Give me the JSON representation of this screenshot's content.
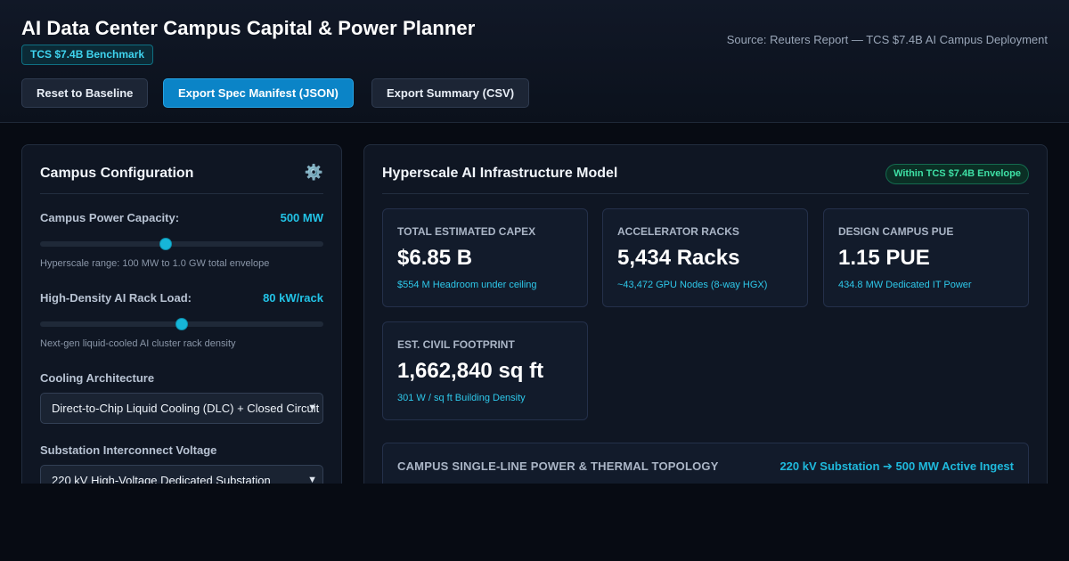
{
  "header": {
    "title": "AI Data Center Campus Capital & Power Planner",
    "badge": "TCS $7.4B Benchmark",
    "source": "Source: Reuters Report — TCS $7.4B AI Campus Deployment",
    "buttons": {
      "reset": "Reset to Baseline",
      "export_json": "Export Spec Manifest (JSON)",
      "export_csv": "Export Summary (CSV)"
    }
  },
  "config": {
    "title": "Campus Configuration",
    "icon": "gear-icon",
    "power": {
      "label": "Campus Power Capacity:",
      "value": "500 MW",
      "slider_fraction": 0.444,
      "hint": "Hyperscale range: 100 MW to 1.0 GW total envelope"
    },
    "rack": {
      "label": "High-Density AI Rack Load:",
      "value": "80 kW/rack",
      "slider_fraction": 0.5,
      "hint": "Next-gen liquid-cooled AI cluster rack density"
    },
    "cooling": {
      "label": "Cooling Architecture",
      "selected": "Direct-to-Chip Liquid Cooling (DLC) + Closed Circuit"
    },
    "substation": {
      "label": "Substation Interconnect Voltage",
      "selected": "220 kV High-Voltage Dedicated Substation"
    }
  },
  "model": {
    "title": "Hyperscale AI Infrastructure Model",
    "status_badge": "Within TCS $7.4B Envelope",
    "cards": [
      {
        "label": "TOTAL ESTIMATED CAPEX",
        "value": "$6.85 B",
        "sub": "$554 M Headroom under ceiling"
      },
      {
        "label": "ACCELERATOR RACKS",
        "value": "5,434 Racks",
        "sub": "~43,472 GPU Nodes (8-way HGX)"
      },
      {
        "label": "DESIGN CAMPUS PUE",
        "value": "1.15 PUE",
        "sub": "434.8 MW Dedicated IT Power"
      },
      {
        "label": "EST. CIVIL FOOTPRINT",
        "value": "1,662,840 sq ft",
        "sub": "301 W / sq ft Building Density"
      }
    ],
    "topology": {
      "title": "CAMPUS SINGLE-LINE POWER & THERMAL TOPOLOGY",
      "status": "220 kV Substation ➔ 500 MW Active Ingest"
    }
  },
  "colors": {
    "accent": "#22c3e6",
    "primary_button": "#0b84c7",
    "success": "#3ee0a5",
    "background": "#070b13"
  }
}
